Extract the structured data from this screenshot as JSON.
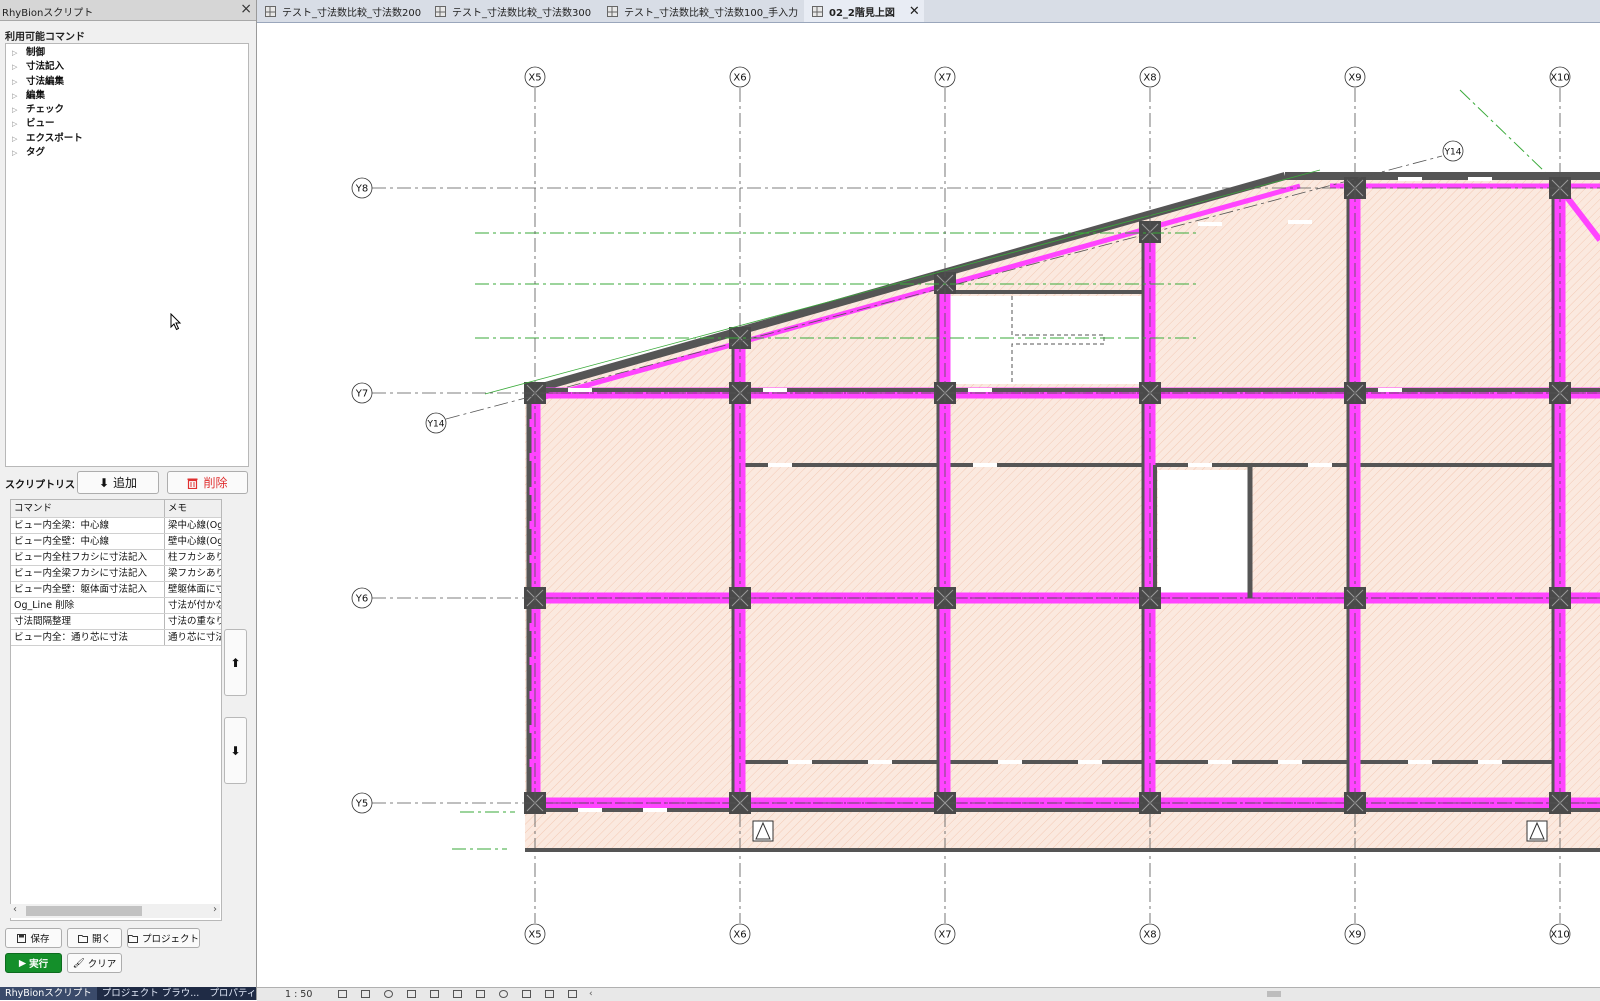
{
  "panel": {
    "title": "RhyBionスクリプト",
    "close_icon": "×"
  },
  "commands": {
    "label": "利用可能コマンド",
    "items": [
      "制御",
      "寸法記入",
      "寸法編集",
      "編集",
      "チェック",
      "ビュー",
      "エクスポート",
      "タグ"
    ]
  },
  "script_list": {
    "label": "スクリプトリスト",
    "add_label": "追加",
    "delete_label": "削除",
    "headers": [
      "コマンド",
      "メモ"
    ],
    "rows": [
      [
        "ビュー内全梁：中心線",
        "梁中心線(Og"
      ],
      [
        "ビュー内全壁：中心線",
        "壁中心線(Og"
      ],
      [
        "ビュー内全柱フカシに寸法記入",
        "柱フカシあり寸"
      ],
      [
        "ビュー内全梁フカシに寸法記入",
        "梁フカシあり寸"
      ],
      [
        "ビュー内全壁：躯体面寸法記入",
        "壁躯体面に寸"
      ],
      [
        "Og_Line 削除",
        "寸法が付かな"
      ],
      [
        "寸法間隔整理",
        "寸法の重なり"
      ],
      [
        "ビュー内全：通り芯に寸法",
        "通り芯に寸法"
      ]
    ],
    "up_icon": "⬆",
    "down_icon": "⬇"
  },
  "actions": {
    "save_label": "保存",
    "open_label": "開く",
    "project_label": "プロジェクト",
    "run_label": "実行",
    "clear_label": "クリア"
  },
  "bottom_tabs": [
    "RhyBionスクリプト",
    "プロジェクト ブラウ...",
    "プロパティ"
  ],
  "tabs": [
    {
      "label": "テスト_寸法数比較_寸法数200",
      "active": false
    },
    {
      "label": "テスト_寸法数比較_寸法数300",
      "active": false
    },
    {
      "label": "テスト_寸法数比較_寸法数100_手入力",
      "active": false
    },
    {
      "label": "02_2階見上図",
      "active": true
    }
  ],
  "drawing": {
    "grid_x_labels": [
      "X5",
      "X6",
      "X7",
      "X8",
      "X9",
      "X10"
    ],
    "grid_y_labels": [
      "Y8",
      "Y7",
      "Y6",
      "Y5"
    ],
    "diagonal_label": "Y14",
    "colors": {
      "grid_line": "#555555",
      "beam": "#ff44ff",
      "wall": "#555555",
      "slab_fill": "#fbe9df",
      "guide_line": "#3aaa3a"
    }
  },
  "status": {
    "scale": "1 : 50"
  }
}
